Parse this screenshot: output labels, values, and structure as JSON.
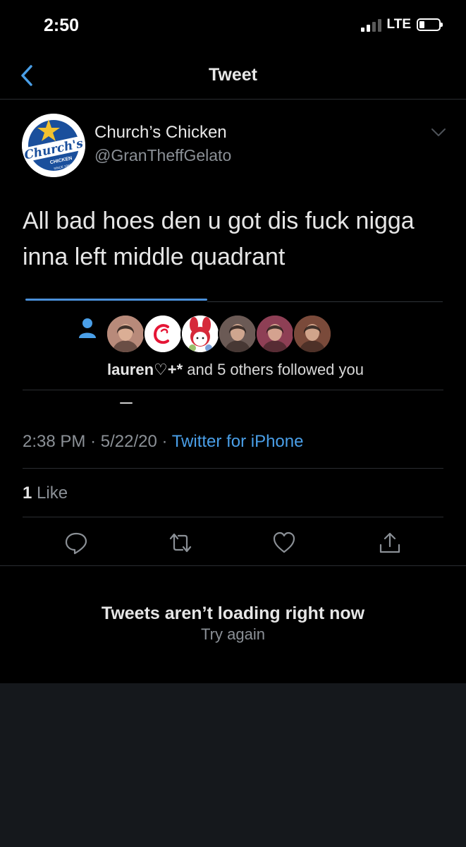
{
  "status_bar": {
    "time": "2:50",
    "network": "LTE"
  },
  "nav": {
    "title": "Tweet"
  },
  "author": {
    "display_name": "Church’s Chicken",
    "handle": "@GranTheffGelato",
    "logo_text": "Church's",
    "logo_subtext": "CHICKEN",
    "logo_since": "SINCE 1952"
  },
  "tweet": {
    "text": "All bad hoes den u got dis fuck nigga inna left middle quadrant",
    "time": "2:38 PM",
    "date": "5/22/20",
    "client": "Twitter for iPhone",
    "separator": "·"
  },
  "follow_card": {
    "name": "lauren♡+*",
    "rest": " and 5 others followed you",
    "faces": [
      {
        "kind": "photo",
        "bg": "#b88a7a"
      },
      {
        "kind": "chickfila",
        "bg": "#ffffff",
        "accent": "#e51636"
      },
      {
        "kind": "melody",
        "bg": "#ffffff",
        "accent": "#d62a3a"
      },
      {
        "kind": "photo",
        "bg": "#6b5a55"
      },
      {
        "kind": "photo",
        "bg": "#8e3f55"
      },
      {
        "kind": "photo",
        "bg": "#7a4a3a"
      }
    ]
  },
  "engagement": {
    "like_count": "1",
    "like_label": " Like"
  },
  "error": {
    "title": "Tweets aren’t loading right now",
    "retry": "Try again"
  },
  "colors": {
    "accent": "#4a9fe8",
    "background": "#000000",
    "muted": "#8b9096"
  }
}
